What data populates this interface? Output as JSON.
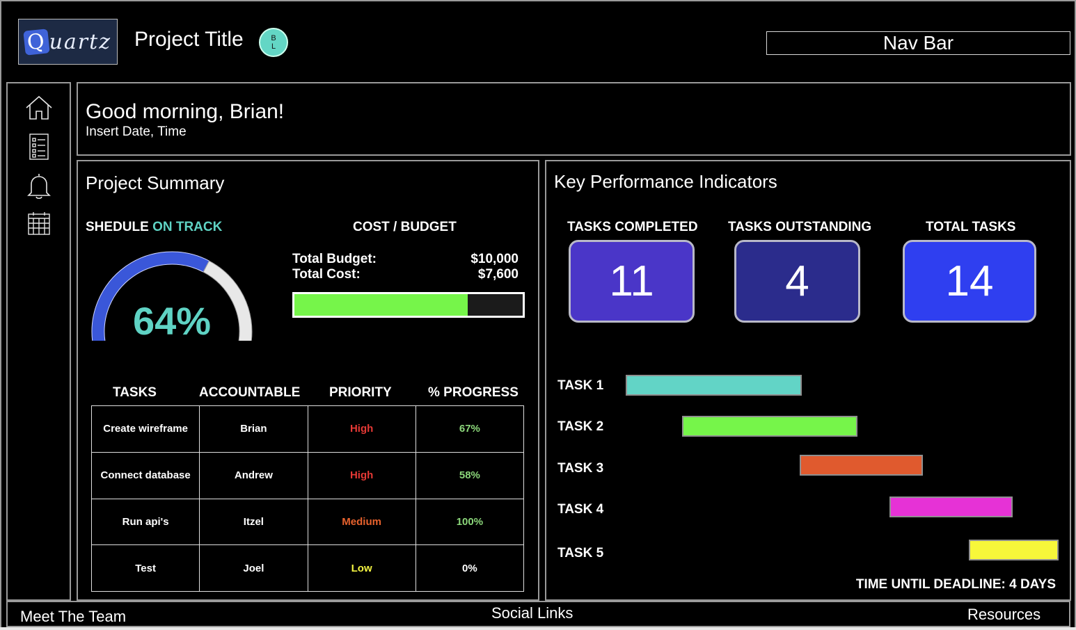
{
  "header": {
    "logo_text": "Quartz",
    "project_title": "Project Title",
    "avatar_initials": [
      "B",
      "L"
    ],
    "nav_bar": "Nav Bar"
  },
  "sidebar": {
    "icons": [
      "home-icon",
      "checklist-icon",
      "bell-icon",
      "calendar-icon"
    ]
  },
  "greeting": {
    "title": "Good morning, Brian!",
    "subtitle": "Insert Date, Time"
  },
  "summary": {
    "title": "Project Summary",
    "schedule_label": "SHEDULE",
    "schedule_status": "ON TRACK",
    "gauge_percent": "64%",
    "gauge_value": 0.64,
    "cost_title": "COST / BUDGET",
    "total_budget_label": "Total Budget:",
    "total_budget_value": "$10,000",
    "total_cost_label": "Total Cost:",
    "total_cost_value": "$7,600",
    "budget_fill": 0.76,
    "table": {
      "headers": [
        "TASKS",
        "ACCOUNTABLE",
        "PRIORITY",
        "% PROGRESS"
      ],
      "rows": [
        {
          "task": "Create wireframe",
          "owner": "Brian",
          "priority": "High",
          "progress": "67%"
        },
        {
          "task": "Connect database",
          "owner": "Andrew",
          "priority": "High",
          "progress": "58%"
        },
        {
          "task": "Run api's",
          "owner": "Itzel",
          "priority": "Medium",
          "progress": "100%"
        },
        {
          "task": "Test",
          "owner": "Joel",
          "priority": "Low",
          "progress": "0%"
        }
      ]
    }
  },
  "kpi": {
    "title": "Key Performance Indicators",
    "cards": [
      {
        "label": "TASKS COMPLETED",
        "value": "11",
        "color": "#4a36c8"
      },
      {
        "label": "TASKS OUTSTANDING",
        "value": "4",
        "color": "#2b2c8c"
      },
      {
        "label": "TOTAL TASKS",
        "value": "14",
        "color": "#2f3ff0"
      }
    ],
    "gantt": [
      {
        "label": "TASK 1",
        "color": "#62d4c6"
      },
      {
        "label": "TASK 2",
        "color": "#76f54a"
      },
      {
        "label": "TASK 3",
        "color": "#e05a2e"
      },
      {
        "label": "TASK 4",
        "color": "#e632d6"
      },
      {
        "label": "TASK 5",
        "color": "#f7f73a"
      }
    ],
    "deadline": "TIME UNTIL DEADLINE: 4 DAYS"
  },
  "footer": {
    "meet_team": "Meet The Team",
    "social_links": "Social Links",
    "resources": "Resources"
  },
  "colors": {
    "high": "#e53935",
    "medium": "#e8622d",
    "low": "#f5f542",
    "progress_green": "#8bd67a",
    "accent_teal": "#5fd3c4"
  }
}
